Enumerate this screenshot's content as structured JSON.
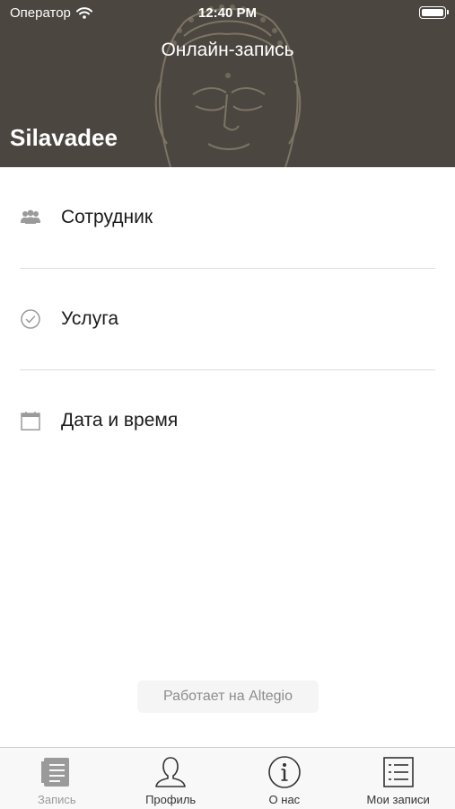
{
  "status_bar": {
    "carrier": "Оператор",
    "time": "12:40 PM"
  },
  "header": {
    "title": "Онлайн-запись",
    "company_name": "Silavadee",
    "background_color": "#4b4640"
  },
  "menu": {
    "items": [
      {
        "label": "Сотрудник",
        "icon": "staff-icon"
      },
      {
        "label": "Услуга",
        "icon": "check-circle-icon"
      },
      {
        "label": "Дата и время",
        "icon": "calendar-icon"
      }
    ]
  },
  "footer": {
    "powered_by": "Работает на Altegio"
  },
  "tabbar": {
    "tabs": [
      {
        "label": "Запись",
        "icon": "booking-icon",
        "active": true
      },
      {
        "label": "Профиль",
        "icon": "profile-icon",
        "active": false
      },
      {
        "label": "О нас",
        "icon": "info-icon",
        "active": false
      },
      {
        "label": "Мои записи",
        "icon": "list-icon",
        "active": false
      }
    ]
  }
}
